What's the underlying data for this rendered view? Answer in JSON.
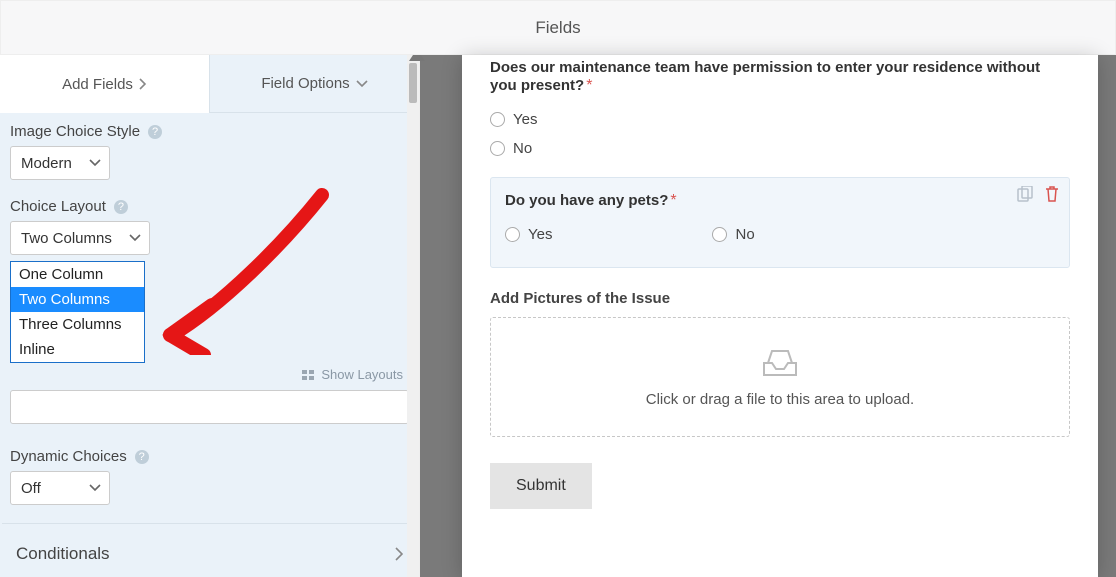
{
  "header": {
    "title": "Fields"
  },
  "tabs": {
    "add": "Add Fields",
    "options": "Field Options"
  },
  "sidebar": {
    "image_choice_style": {
      "label": "Image Choice Style",
      "value": "Modern"
    },
    "choice_layout": {
      "label": "Choice Layout",
      "value": "Two Columns",
      "options": [
        "One Column",
        "Two Columns",
        "Three Columns",
        "Inline"
      ],
      "selected_index": 1,
      "show_layouts": "Show Layouts"
    },
    "dynamic_choices": {
      "label": "Dynamic Choices",
      "value": "Off"
    },
    "conditionals": {
      "label": "Conditionals"
    }
  },
  "form": {
    "q1": {
      "label": "Does our maintenance team have permission to enter your residence without you present?",
      "opts": [
        "Yes",
        "No"
      ]
    },
    "q2": {
      "label": "Do you have any pets?",
      "opts": [
        "Yes",
        "No"
      ]
    },
    "upload": {
      "label": "Add Pictures of the Issue",
      "hint": "Click or drag a file to this area to upload."
    },
    "submit": "Submit"
  }
}
